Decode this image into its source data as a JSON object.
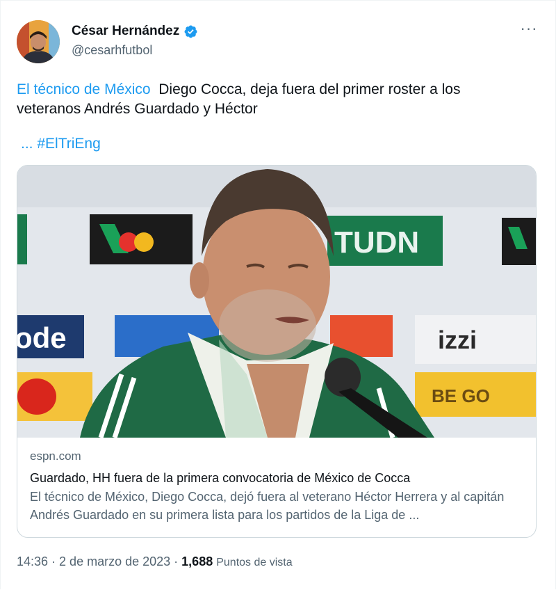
{
  "author": {
    "name": "César Hernández",
    "handle": "@cesarhfutbol",
    "verified": true
  },
  "tweet": {
    "link_text": "El técnico de México",
    "text": "Diego Cocca, deja fuera del primer roster a los veteranos Andrés Guardado y Héctor",
    "hashtag_line": "... #ElTriEng"
  },
  "card": {
    "domain": "espn.com",
    "title": "Guardado, HH fuera de la primera convocatoria de México de Cocca",
    "description": "El técnico de México, Diego Cocca, dejó fuera al veterano Héctor Herrera y al capitán Andrés Guardado en su primera lista para los partidos de la Liga de ...",
    "image_sponsors": [
      "TUDN",
      "izzi",
      "BE GO",
      "ode"
    ]
  },
  "footer": {
    "time": "14:36",
    "separator": "·",
    "date": "2 de marzo de 2023",
    "views_count": "1,688",
    "views_label": "Puntos de vista"
  },
  "icons": {
    "more": "more-options-icon",
    "verified": "verified-badge-icon"
  },
  "colors": {
    "link": "#1d9bf0",
    "secondary_text": "#536471",
    "primary_text": "#0f1419",
    "border": "#cfd9de",
    "tudn_green": "#1a7a4c",
    "shirt_green": "#1f6a45"
  }
}
